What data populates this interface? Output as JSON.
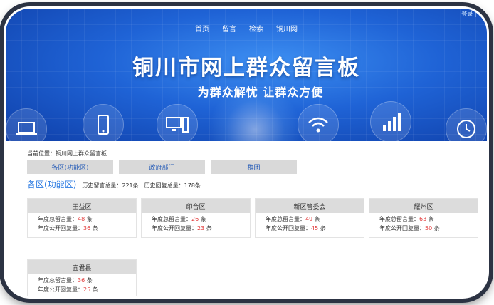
{
  "header": {
    "login": "登录 | 注",
    "nav": [
      "首页",
      "留言",
      "检索",
      "铜川网"
    ],
    "title": "铜川市网上群众留言板",
    "subtitle": "为群众解忧  让群众方便"
  },
  "icons": [
    "laptop-icon",
    "phone-icon",
    "desktop-icon",
    "wifi-icon",
    "signal-icon",
    "clock-icon"
  ],
  "breadcrumb": "当前位置：铜川网上群众留言板",
  "tabs": [
    "各区(功能区)",
    "政府部门",
    "群团"
  ],
  "section": {
    "title": "各区(功能区)",
    "total_messages": "历史留言总量：221条",
    "total_replies": "历史回复总量：178条"
  },
  "districts": [
    {
      "name": "王益区",
      "msg_label": "年度总留言量：",
      "msg": "48",
      "reply_label": "年度公开回复量：",
      "reply": "36",
      "unit": "条"
    },
    {
      "name": "印台区",
      "msg_label": "年度总留言量：",
      "msg": "26",
      "reply_label": "年度公开回复量：",
      "reply": "23",
      "unit": "条"
    },
    {
      "name": "新区管委会",
      "msg_label": "年度总留言量：",
      "msg": "49",
      "reply_label": "年度公开回复量：",
      "reply": "45",
      "unit": "条"
    },
    {
      "name": "耀州区",
      "msg_label": "年度总留言量：",
      "msg": "63",
      "reply_label": "年度公开回复量：",
      "reply": "50",
      "unit": "条"
    },
    {
      "name": "宜君县",
      "msg_label": "年度总留言量：",
      "msg": "36",
      "reply_label": "年度公开回复量：",
      "reply": "25",
      "unit": "条"
    }
  ],
  "colors": {
    "accent": "#2a7ae2",
    "banner": "#1f63d6",
    "number": "#e23a3a"
  }
}
